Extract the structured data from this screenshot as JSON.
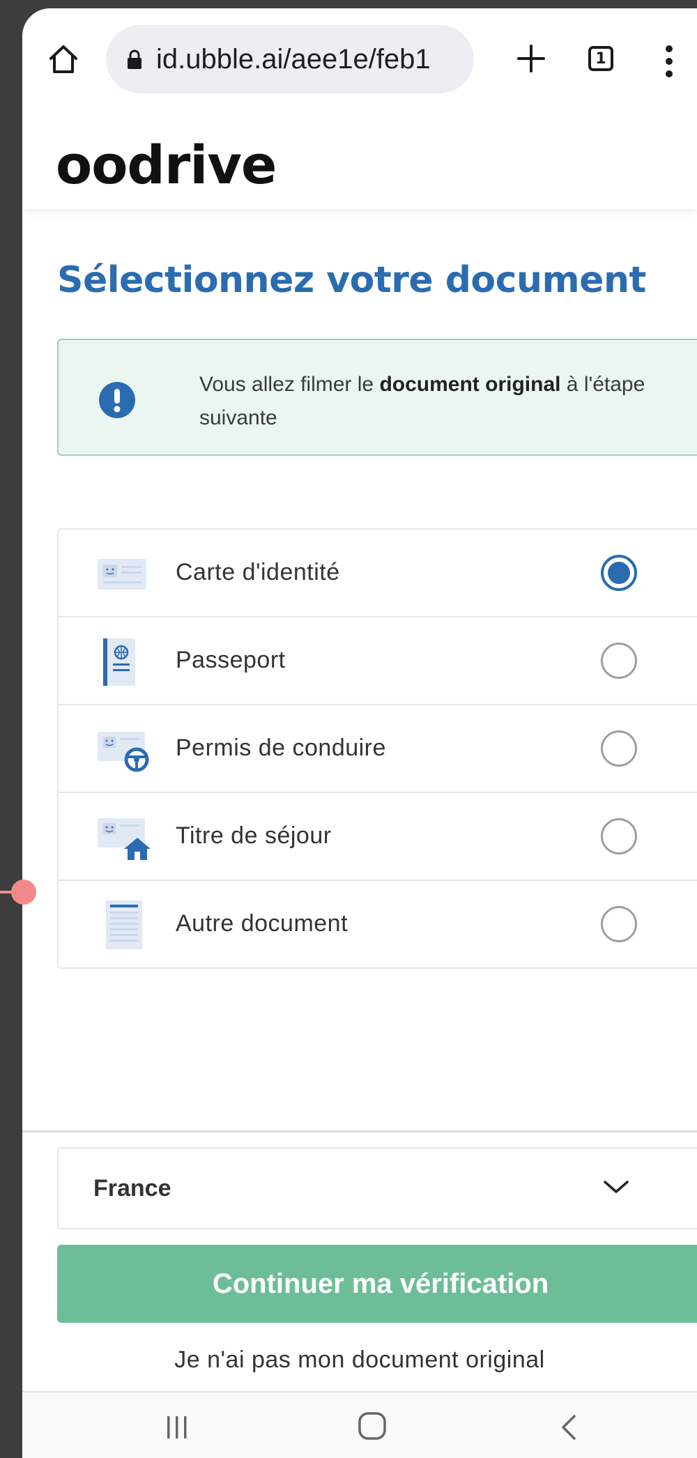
{
  "browser": {
    "url": "id.ubble.ai/aee1e/feb1",
    "tab_count": "1"
  },
  "site": {
    "logo": "oodrive"
  },
  "page": {
    "title": "Sélectionnez votre document"
  },
  "info": {
    "text_before": "Vous allez filmer le ",
    "text_bold": "document original",
    "text_after": " à l'étape suivante"
  },
  "documents": [
    {
      "label": "Carte d'identité",
      "icon": "id-card-icon",
      "selected": true
    },
    {
      "label": "Passeport",
      "icon": "passport-icon",
      "selected": false
    },
    {
      "label": "Permis de conduire",
      "icon": "driving-license-icon",
      "selected": false
    },
    {
      "label": "Titre de séjour",
      "icon": "residence-permit-icon",
      "selected": false
    },
    {
      "label": "Autre document",
      "icon": "other-document-icon",
      "selected": false
    }
  ],
  "country": {
    "value": "France"
  },
  "actions": {
    "continue_label": "Continuer ma vérification",
    "no_document_label": "Je n'ai pas mon document original"
  },
  "colors": {
    "accent": "#2b6cb0",
    "button": "#6dbe98",
    "info_bg": "#ebf6f1"
  }
}
